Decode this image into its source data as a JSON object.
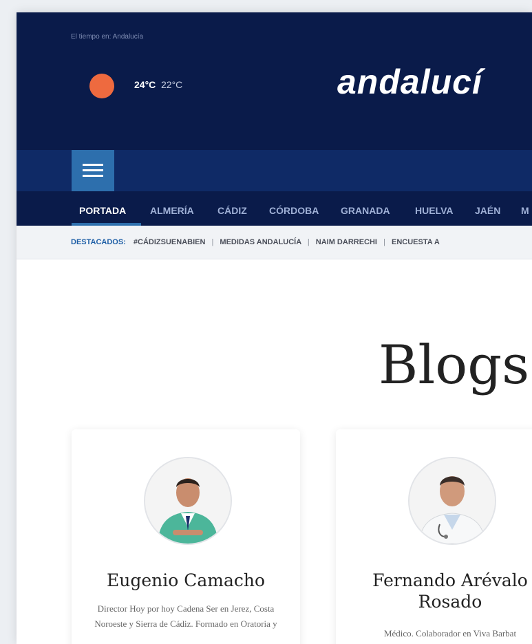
{
  "weather": {
    "label": "El tiempo en: Andalucía",
    "max": "24°C",
    "min": "22°C",
    "icon": "sun-icon",
    "sun_color": "#ee6a3f"
  },
  "brand": {
    "logo_text": "andalucí"
  },
  "menu": {
    "icon": "hamburger-menu-icon"
  },
  "nav": {
    "items": [
      "PORTADA",
      "ALMERÍA",
      "CÁDIZ",
      "CÓRDOBA",
      "GRANADA",
      "HUELVA",
      "JAÉN",
      "M"
    ],
    "active": "PORTADA"
  },
  "tags": {
    "head": "DESTACADOS:",
    "items": [
      "#CÁDIZSUENABIEN",
      "MEDIDAS ANDALUCÍA",
      "NAIM DARRECHI",
      "ENCUESTA A"
    ],
    "separator": "|"
  },
  "section": {
    "title": "Blogs d"
  },
  "cards": [
    {
      "name": "Eugenio Camacho",
      "description": "Director Hoy por hoy Cadena Ser en Jerez, Costa Noroeste y Sierra de Cádiz. Formado en Oratoria y"
    },
    {
      "name": "Fernando Arévalo Rosado",
      "description": "Médico. Colaborador en Viva Barbat"
    }
  ],
  "colors": {
    "header_bg": "#0a1b4a",
    "menu_bg": "#0f2a66",
    "accent": "#2d6fad",
    "tag_head": "#1f5fa6"
  }
}
